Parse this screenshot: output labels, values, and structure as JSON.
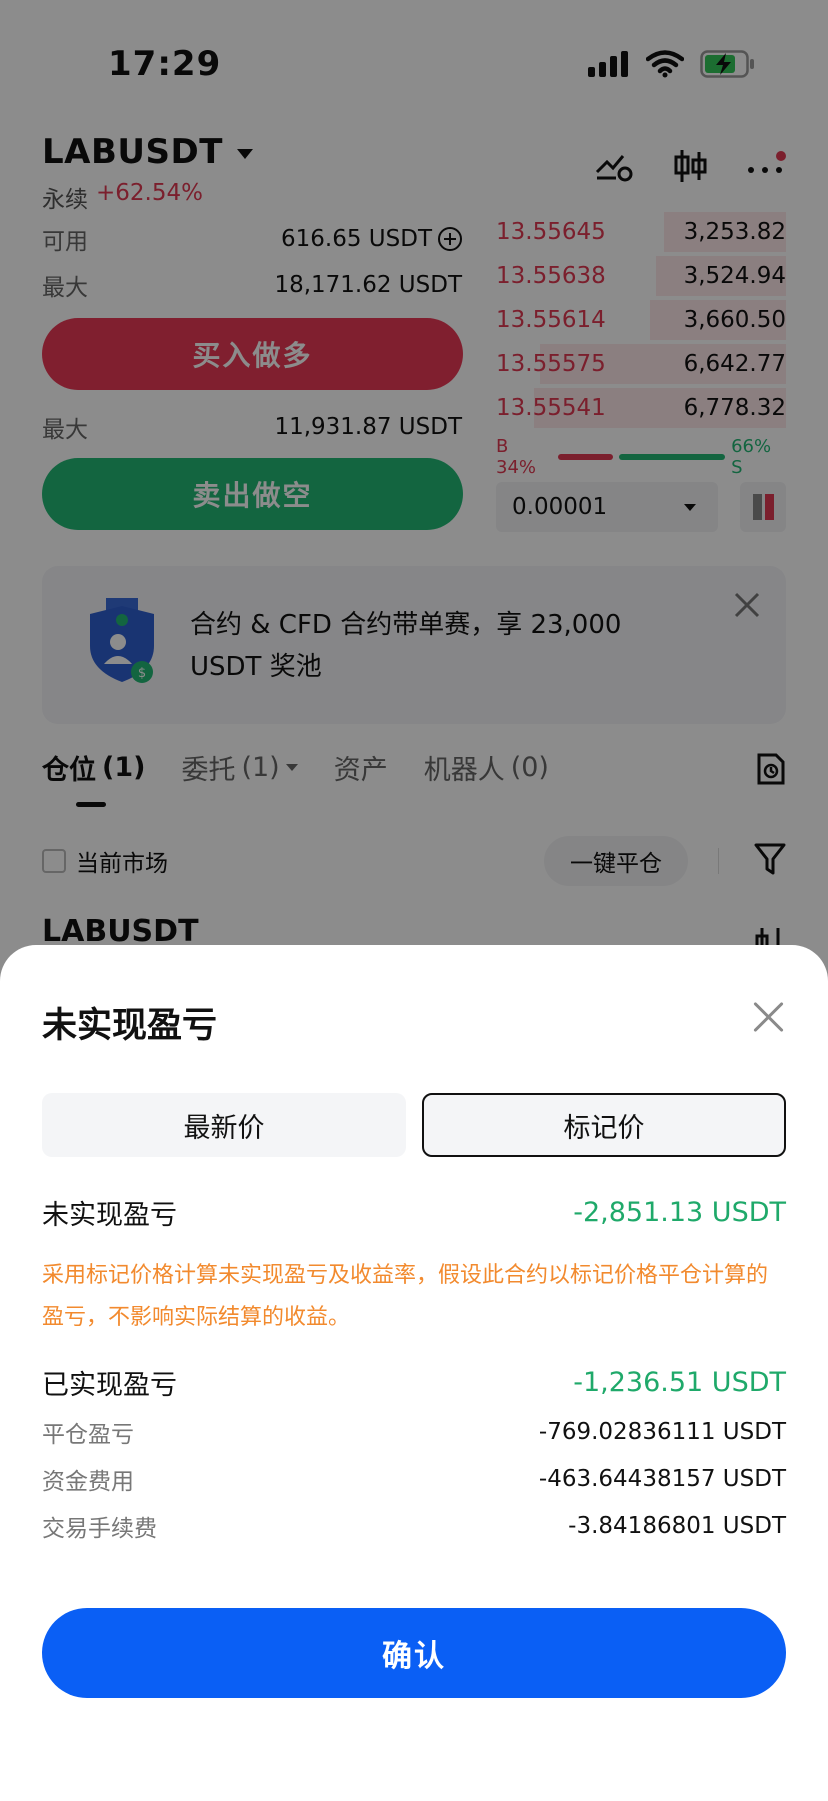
{
  "status_bar": {
    "time": "17:29"
  },
  "header": {
    "pair": "LABUSDT",
    "contract_type": "永续",
    "change": "+62.54%"
  },
  "trade": {
    "available_label": "可用",
    "available_value": "616.65 USDT",
    "max_buy_label": "最大",
    "max_buy_value": "18,171.62 USDT",
    "buy_label": "买入做多",
    "max_sell_label": "最大",
    "max_sell_value": "11,931.87 USDT",
    "sell_label": "卖出做空"
  },
  "orderbook": {
    "asks": [
      {
        "price": "13.55645",
        "qty": "3,253.82",
        "depth": 0.42
      },
      {
        "price": "13.55638",
        "qty": "3,524.94",
        "depth": 0.45
      },
      {
        "price": "13.55614",
        "qty": "3,660.50",
        "depth": 0.47
      },
      {
        "price": "13.55575",
        "qty": "6,642.77",
        "depth": 0.85
      },
      {
        "price": "13.55541",
        "qty": "6,778.32",
        "depth": 0.87
      }
    ],
    "buy_ratio": "B 34%",
    "sell_ratio": "66% S",
    "buy_ratio_fraction": 0.34,
    "precision": "0.00001"
  },
  "banner": {
    "text": "合约 & CFD 合约带单赛，享 23,000 USDT 奖池"
  },
  "tabs": [
    {
      "label": "仓位",
      "count": "(1)"
    },
    {
      "label": "委托",
      "count": "(1)"
    },
    {
      "label": "资产",
      "count": ""
    },
    {
      "label": "机器人",
      "count": "(0)"
    }
  ],
  "filter": {
    "current_market_label": "当前市场",
    "close_all_label": "一键平仓"
  },
  "position": {
    "name": "LABUSDT"
  },
  "sheet": {
    "title": "未实现盈亏",
    "seg_latest": "最新价",
    "seg_mark": "标记价",
    "unrealized_label": "未实现盈亏",
    "unrealized_value": "-2,851.13 USDT",
    "note": "采用标记价格计算未实现盈亏及收益率，假设此合约以标记价格平仓计算的盈亏，不影响实际结算的收益。",
    "realized_label": "已实现盈亏",
    "realized_value": "-1,236.51 USDT",
    "close_pnl_label": "平仓盈亏",
    "close_pnl_value": "-769.02836111 USDT",
    "funding_label": "资金费用",
    "funding_value": "-463.64438157 USDT",
    "fee_label": "交易手续费",
    "fee_value": "-3.84186801 USDT",
    "confirm_label": "确认"
  },
  "colors": {
    "buy": "#ea3a56",
    "sell": "#23b876",
    "profit_green": "#1fa96a",
    "note_orange": "#f28a2e",
    "confirm_blue": "#0a5ff5"
  }
}
